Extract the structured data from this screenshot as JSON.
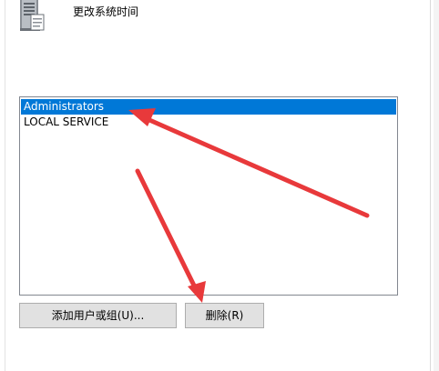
{
  "policy": {
    "title": "更改系统时间",
    "icon": "server-policy-icon"
  },
  "accounts": {
    "items": [
      {
        "label": "Administrators",
        "selected": true
      },
      {
        "label": "LOCAL SERVICE",
        "selected": false
      }
    ]
  },
  "buttons": {
    "add_label": "添加用户或组(U)...",
    "remove_label": "删除(R)"
  },
  "colors": {
    "selection": "#0078d7",
    "annotation_arrow": "#e8393b",
    "button_face": "#e1e1e1"
  }
}
